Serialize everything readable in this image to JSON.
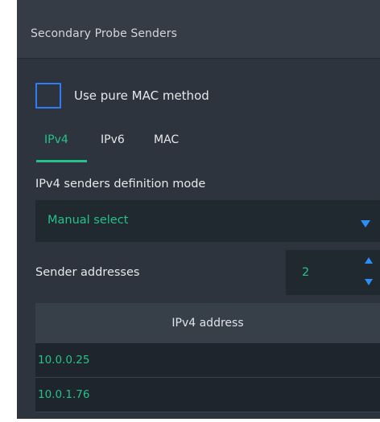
{
  "panel": {
    "title": "Secondary Probe Senders"
  },
  "checkbox": {
    "label": "Use pure MAC method",
    "checked": false
  },
  "tabs": [
    {
      "label": "IPv4",
      "active": true
    },
    {
      "label": "IPv6",
      "active": false
    },
    {
      "label": "MAC",
      "active": false
    }
  ],
  "mode": {
    "label": "IPv4 senders definition mode",
    "value": "Manual select",
    "arrow_icon": "chevron-down-icon"
  },
  "senders": {
    "label": "Sender addresses",
    "value": "2",
    "up_icon": "arrow-up-icon",
    "down_icon": "arrow-down-icon"
  },
  "table": {
    "header": "IPv4 address",
    "rows": [
      "10.0.0.25",
      "10.0.1.76"
    ]
  },
  "colors": {
    "accent_green": "#25c28a",
    "accent_blue": "#2f8ef6",
    "panel_bg": "#2d343d",
    "field_bg": "#202830"
  }
}
